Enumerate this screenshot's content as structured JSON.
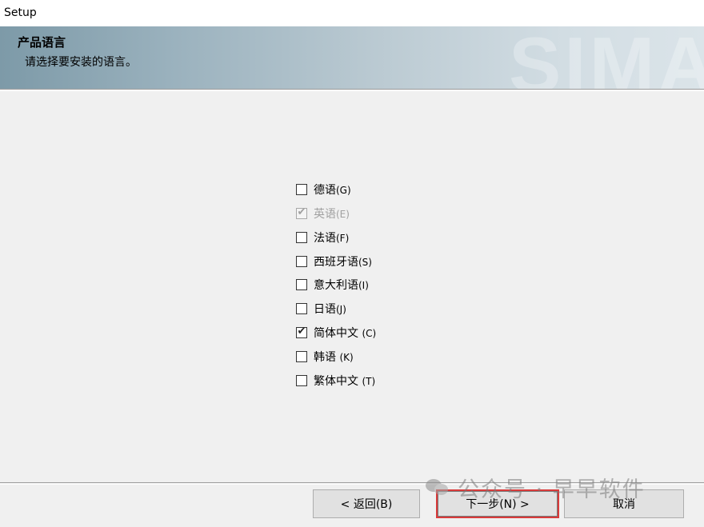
{
  "window": {
    "title": "Setup"
  },
  "banner": {
    "heading": "产品语言",
    "subheading": "请选择要安装的语言。",
    "watermark": "SIMA"
  },
  "languages": [
    {
      "label": "德语",
      "shortcut": "(G)",
      "checked": false,
      "disabled": false
    },
    {
      "label": "英语",
      "shortcut": "(E)",
      "checked": true,
      "disabled": true
    },
    {
      "label": "法语",
      "shortcut": "(F)",
      "checked": false,
      "disabled": false
    },
    {
      "label": "西班牙语",
      "shortcut": "(S)",
      "checked": false,
      "disabled": false
    },
    {
      "label": "意大利语",
      "shortcut": "(I)",
      "checked": false,
      "disabled": false
    },
    {
      "label": "日语",
      "shortcut": "(J)",
      "checked": false,
      "disabled": false
    },
    {
      "label": "简体中文 ",
      "shortcut": "(C)",
      "checked": true,
      "disabled": false
    },
    {
      "label": "韩语 ",
      "shortcut": "(K)",
      "checked": false,
      "disabled": false
    },
    {
      "label": "繁体中文 ",
      "shortcut": "(T)",
      "checked": false,
      "disabled": false
    }
  ],
  "buttons": {
    "back": "< 返回(B)",
    "next": "下一步(N) >",
    "cancel": "取消"
  },
  "overlay_watermark": "公众号 · 早早软件",
  "icons": {
    "check": "check-mark-icon",
    "wechat": "wechat-icon"
  },
  "colors": {
    "highlight_border": "#d93a3a",
    "banner_left": "#7d9aa8",
    "banner_right": "#dbe4e9"
  }
}
